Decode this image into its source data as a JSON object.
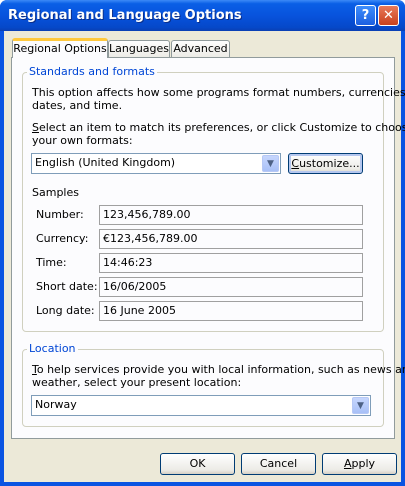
{
  "window": {
    "title": "Regional and Language Options",
    "help_glyph": "?",
    "close_glyph": "✕"
  },
  "tabs": [
    {
      "label": "Regional Options",
      "active": true
    },
    {
      "label": "Languages",
      "active": false
    },
    {
      "label": "Advanced",
      "active": false
    }
  ],
  "standards": {
    "legend": "Standards and formats",
    "desc_line1": "This option affects how some programs format numbers, currencies,",
    "desc_line2": "dates, and time.",
    "select_line1_hotkey": "S",
    "select_line1_rest": "elect an item to match its preferences, or click Customize to choose",
    "select_line2": "your own formats:",
    "format_value": "English (United Kingdom)",
    "customize_hotkey": "C",
    "customize_rest": "ustomize..."
  },
  "samples": {
    "heading": "Samples",
    "rows": [
      {
        "label": "Number:",
        "value": "123,456,789.00"
      },
      {
        "label": "Currency:",
        "value": "€123,456,789.00"
      },
      {
        "label": "Time:",
        "value": "14:46:23"
      },
      {
        "label": "Short date:",
        "value": "16/06/2005"
      },
      {
        "label": "Long date:",
        "value": "16 June 2005"
      }
    ]
  },
  "location": {
    "legend": "Location",
    "desc_line1_hotkey": "T",
    "desc_line1_rest": "o help services provide you with local information, such as news and",
    "desc_line2": "weather, select your present location:",
    "value": "Norway"
  },
  "footer": {
    "ok": "OK",
    "cancel": "Cancel",
    "apply_hotkey": "A",
    "apply_rest": "pply"
  },
  "colors": {
    "titlebar": "#0a54e2",
    "dialog_bg": "#ece9d8",
    "legend_text": "#0046d5",
    "active_tab_accent": "#ffc83c"
  }
}
